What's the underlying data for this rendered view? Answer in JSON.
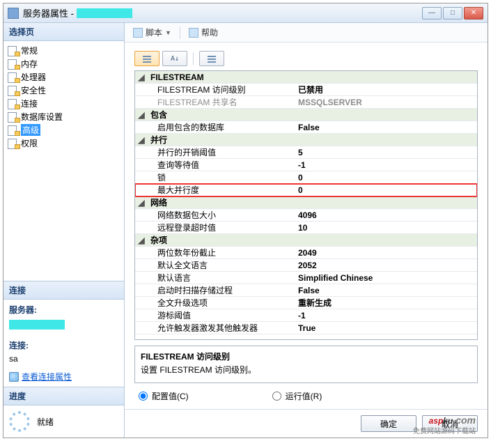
{
  "title": {
    "prefix": "服务器属性 - ",
    "redacted": "XXXXXXXXX"
  },
  "winbtns": {
    "min": "—",
    "max": "□",
    "close": "✕"
  },
  "left": {
    "select_header": "选择页",
    "pages": [
      {
        "label": "常规"
      },
      {
        "label": "内存"
      },
      {
        "label": "处理器"
      },
      {
        "label": "安全性"
      },
      {
        "label": "连接"
      },
      {
        "label": "数据库设置"
      },
      {
        "label": "高级",
        "selected": true
      },
      {
        "label": "权限"
      }
    ],
    "conn": {
      "header": "连接",
      "server_lbl": "服务器:",
      "server_val": "XXXXXXXXX",
      "conn_lbl": "连接:",
      "conn_val": "sa",
      "view_link": "查看连接属性"
    },
    "prog": {
      "header": "进度",
      "status": "就绪"
    }
  },
  "toolbar": {
    "script": "脚本",
    "dd": "▼",
    "help": "帮助"
  },
  "grid": {
    "rows": [
      {
        "type": "cat",
        "exp": "◢",
        "k": "FILESTREAM"
      },
      {
        "type": "sub",
        "k": "FILESTREAM 访问级别",
        "v": "已禁用"
      },
      {
        "type": "sub dis",
        "k": "FILESTREAM 共享名",
        "v": "MSSQLSERVER"
      },
      {
        "type": "cat",
        "exp": "◢",
        "k": "包含"
      },
      {
        "type": "sub",
        "k": "启用包含的数据库",
        "v": "False"
      },
      {
        "type": "cat",
        "exp": "◢",
        "k": "并行"
      },
      {
        "type": "sub",
        "k": "并行的开销阈值",
        "v": "5"
      },
      {
        "type": "sub",
        "k": "查询等待值",
        "v": "-1"
      },
      {
        "type": "sub",
        "k": "锁",
        "v": "0"
      },
      {
        "type": "sub hl",
        "k": "最大并行度",
        "v": "0"
      },
      {
        "type": "cat",
        "exp": "◢",
        "k": "网络"
      },
      {
        "type": "sub",
        "k": "网络数据包大小",
        "v": "4096"
      },
      {
        "type": "sub",
        "k": "远程登录超时值",
        "v": "10"
      },
      {
        "type": "cat",
        "exp": "◢",
        "k": "杂项"
      },
      {
        "type": "sub",
        "k": "两位数年份截止",
        "v": "2049"
      },
      {
        "type": "sub",
        "k": "默认全文语言",
        "v": "2052"
      },
      {
        "type": "sub",
        "k": "默认语言",
        "v": "Simplified Chinese"
      },
      {
        "type": "sub",
        "k": "启动时扫描存储过程",
        "v": "False"
      },
      {
        "type": "sub",
        "k": "全文升级选项",
        "v": "重新生成"
      },
      {
        "type": "sub",
        "k": "游标阈值",
        "v": "-1"
      },
      {
        "type": "sub",
        "k": "允许触发器激发其他触发器",
        "v": "True"
      }
    ],
    "desc": {
      "title": "FILESTREAM 访问级别",
      "body": "设置 FILESTREAM 访问级别。"
    }
  },
  "radios": {
    "configured": "配置值(C)",
    "running": "运行值(R)"
  },
  "buttons": {
    "ok": "确定",
    "cancel": "取消"
  },
  "watermark": {
    "t1": "asp",
    "t2": "ku",
    "sub": ".com",
    "tag": "免费网站源码下载站"
  }
}
